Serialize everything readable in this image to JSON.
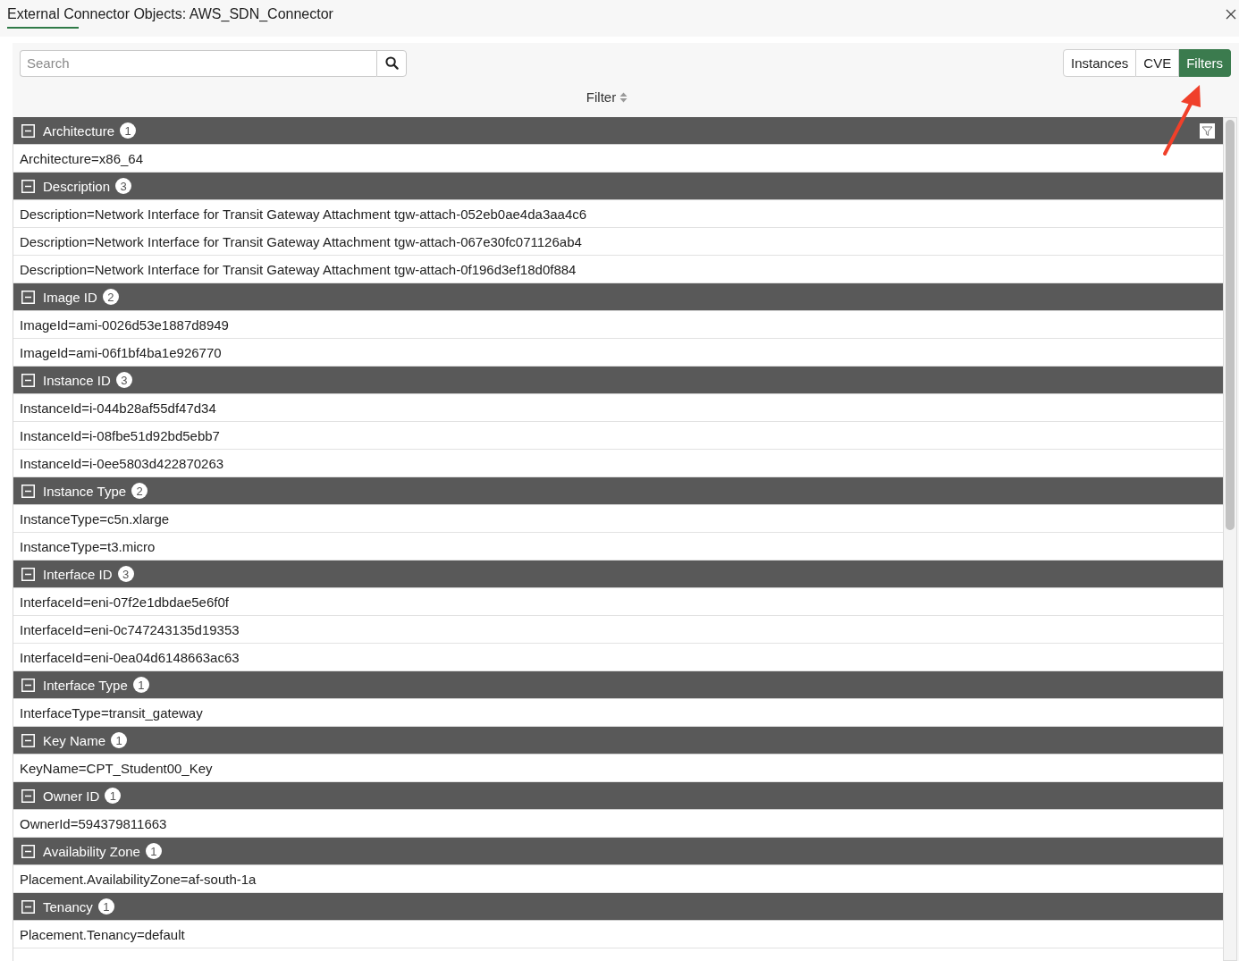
{
  "window": {
    "title": "External Connector Objects: AWS_SDN_Connector"
  },
  "toolbar": {
    "search": {
      "placeholder": "Search"
    },
    "tabs": [
      {
        "label": "Instances",
        "selected": false
      },
      {
        "label": "CVE",
        "selected": false
      },
      {
        "label": "Filters",
        "selected": true
      }
    ]
  },
  "table": {
    "column": "Filter",
    "groups": [
      {
        "name": "Architecture",
        "count": "1",
        "expanded": true,
        "rows": [
          "Architecture=x86_64"
        ]
      },
      {
        "name": "Description",
        "count": "3",
        "expanded": true,
        "rows": [
          "Description=Network Interface for Transit Gateway Attachment tgw-attach-052eb0ae4da3aa4c6",
          "Description=Network Interface for Transit Gateway Attachment tgw-attach-067e30fc071126ab4",
          "Description=Network Interface for Transit Gateway Attachment tgw-attach-0f196d3ef18d0f884"
        ]
      },
      {
        "name": "Image ID",
        "count": "2",
        "expanded": true,
        "rows": [
          "ImageId=ami-0026d53e1887d8949",
          "ImageId=ami-06f1bf4ba1e926770"
        ]
      },
      {
        "name": "Instance ID",
        "count": "3",
        "expanded": true,
        "rows": [
          "InstanceId=i-044b28af55df47d34",
          "InstanceId=i-08fbe51d92bd5ebb7",
          "InstanceId=i-0ee5803d422870263"
        ]
      },
      {
        "name": "Instance Type",
        "count": "2",
        "expanded": true,
        "rows": [
          "InstanceType=c5n.xlarge",
          "InstanceType=t3.micro"
        ]
      },
      {
        "name": "Interface ID",
        "count": "3",
        "expanded": true,
        "rows": [
          "InterfaceId=eni-07f2e1dbdae5e6f0f",
          "InterfaceId=eni-0c747243135d19353",
          "InterfaceId=eni-0ea04d6148663ac63"
        ]
      },
      {
        "name": "Interface Type",
        "count": "1",
        "expanded": true,
        "rows": [
          "InterfaceType=transit_gateway"
        ]
      },
      {
        "name": "Key Name",
        "count": "1",
        "expanded": true,
        "rows": [
          "KeyName=CPT_Student00_Key"
        ]
      },
      {
        "name": "Owner ID",
        "count": "1",
        "expanded": true,
        "rows": [
          "OwnerId=594379811663"
        ]
      },
      {
        "name": "Availability Zone",
        "count": "1",
        "expanded": true,
        "rows": [
          "Placement.AvailabilityZone=af-south-1a"
        ]
      },
      {
        "name": "Tenancy",
        "count": "1",
        "expanded": true,
        "rows": [
          "Placement.Tenancy=default"
        ]
      }
    ]
  }
}
